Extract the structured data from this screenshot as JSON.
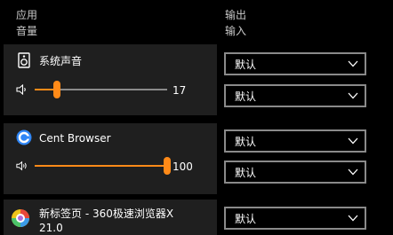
{
  "headers": {
    "app": "应用",
    "volume": "音量",
    "output": "输出",
    "input": "输入"
  },
  "apps": [
    {
      "name": "系统声音",
      "icon": "speaker-icon",
      "volume": 17,
      "output": "默认",
      "input": "默认"
    },
    {
      "name": "Cent Browser",
      "icon": "cent-browser-icon",
      "volume": 100,
      "output": "默认",
      "input": "默认"
    },
    {
      "name_line1": "新标签页 - 360极速浏览器X",
      "name_line2": "21.0",
      "icon": "360-browser-icon",
      "output": "默认"
    }
  ],
  "colors": {
    "accent": "#ff8a18",
    "panel": "#1f1f1f",
    "track": "#8a8a8a",
    "background": "#000000"
  }
}
